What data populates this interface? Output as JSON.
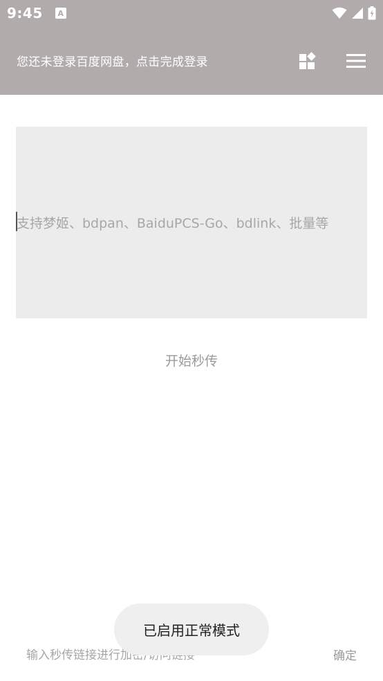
{
  "status_bar": {
    "time": "9:45",
    "app_icon_letter": "A",
    "icons": [
      "wifi-icon",
      "cell-signal-icon",
      "battery-icon"
    ]
  },
  "app_bar": {
    "title": "您还未登录百度网盘，点击完成登录",
    "actions": [
      "widgets-icon",
      "menu-icon"
    ]
  },
  "link_input": {
    "placeholder": "支持梦姬、bdpan、BaiduPCS-Go、bdlink、批量等"
  },
  "start_button": {
    "label": "开始秒传"
  },
  "bottom": {
    "input_placeholder": "输入秒传链接进行加密/访问链接",
    "confirm_label": "确定"
  },
  "toast": {
    "message": "已启用正常模式"
  },
  "colors": {
    "app_bar": "#b2abac",
    "input_bg": "#ececec",
    "toast_bg": "#efefef"
  }
}
